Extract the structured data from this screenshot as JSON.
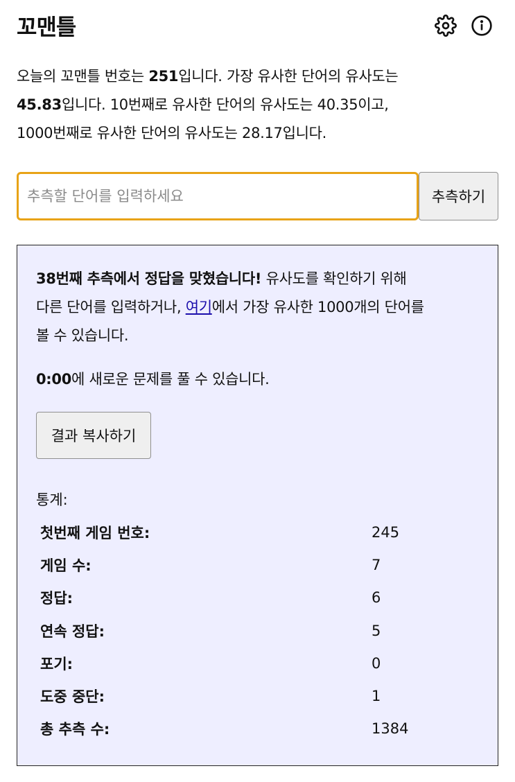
{
  "header": {
    "title": "꼬맨틀",
    "settings_icon": "gear-icon",
    "info_icon": "info-icon"
  },
  "summary": {
    "p1": "오늘의 꼬맨틀 번호는 ",
    "puzzle_number": "251",
    "p2": "입니다. 가장 유사한 단어의 유사도는",
    "top_similarity": "45.83",
    "p3": "입니다. 10번째로 유사한 단어의 유사도는 40.35이고,",
    "line3": "1000번째로 유사한 단어의 유사도는 28.17입니다."
  },
  "guess": {
    "placeholder": "추측할 단어를 입력하세요",
    "button_label": "추측하기"
  },
  "response": {
    "success_bold": "38번째 추측에서 정답을 맞혔습니다!",
    "success_rest1": " 유사도를 확인하기 위해",
    "line2_pre": "다른 단어를 입력하거나, ",
    "link_text": "여기",
    "line2_post": "에서 가장 유사한 1000개의 단어를",
    "line3": "볼 수 있습니다.",
    "reset_time": "0:00",
    "reset_rest": "에 새로운 문제를 풀 수 있습니다.",
    "copy_button_label": "결과 복사하기"
  },
  "stats": {
    "label": "통계:",
    "rows": [
      {
        "label": "첫번째 게임 번호:",
        "value": "245"
      },
      {
        "label": "게임 수:",
        "value": "7"
      },
      {
        "label": "정답:",
        "value": "6"
      },
      {
        "label": "연속 정답:",
        "value": "5"
      },
      {
        "label": "포기:",
        "value": "0"
      },
      {
        "label": "도중 중단:",
        "value": "1"
      },
      {
        "label": "총 추측 수:",
        "value": "1384"
      }
    ]
  },
  "colors": {
    "input_border": "#e8a317",
    "response_bg": "#eeeeff",
    "link": "#1a0dab"
  }
}
